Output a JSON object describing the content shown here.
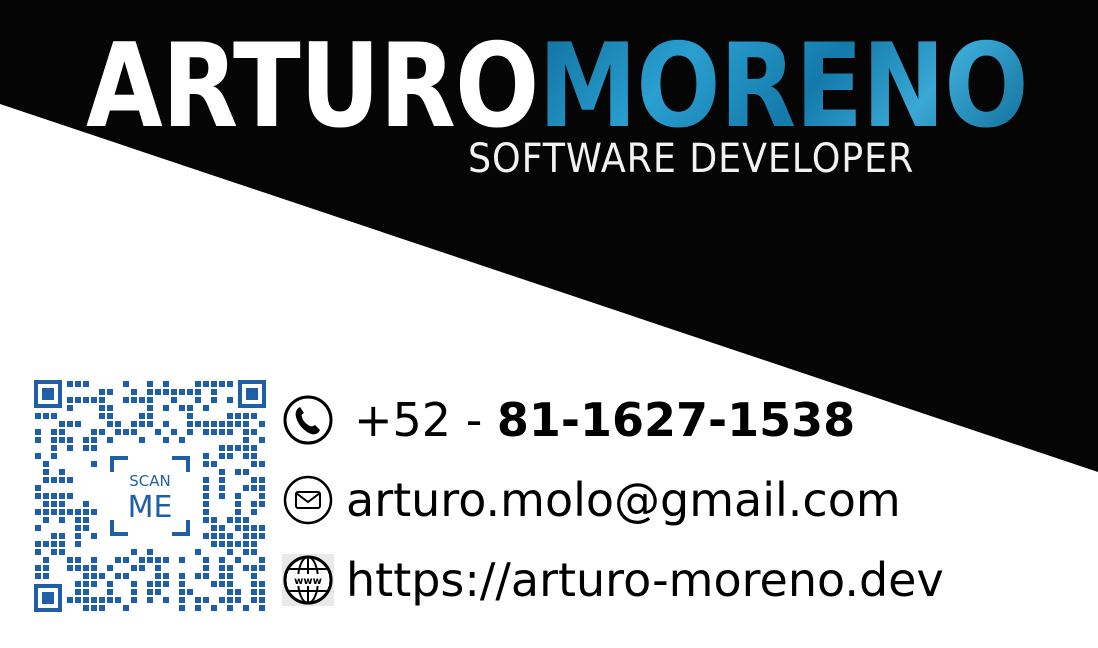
{
  "name": {
    "first": "ARTURO",
    "last": "MORENO"
  },
  "title": "SOFTWARE DEVELOPER",
  "qr": {
    "scan_top": "SCAN",
    "scan_bottom": "ME"
  },
  "contact": {
    "phone_prefix": "+52 - ",
    "phone_number": "81-1627-1538",
    "email": "arturo.molo@gmail.com",
    "website": "https://arturo-moreno.dev",
    "web_icon_text": "www"
  },
  "colors": {
    "black": "#050505",
    "white": "#ffffff",
    "accent_blue": "#1a85b8",
    "qr_blue": "#1f5fa8"
  },
  "icons": [
    "phone-icon",
    "email-icon",
    "globe-icon",
    "qr-code"
  ]
}
